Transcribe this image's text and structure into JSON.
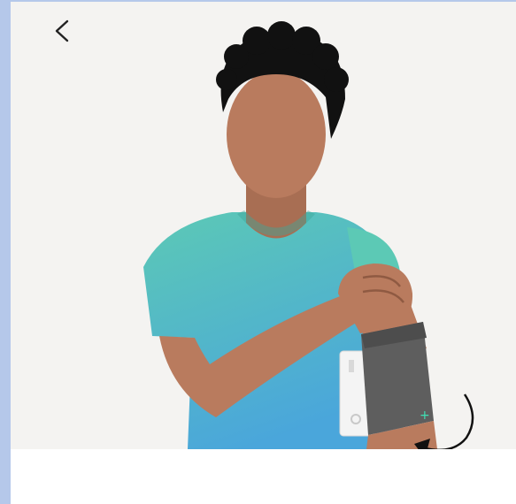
{
  "header": {
    "back_icon": "chevron-left-icon"
  },
  "illustration": {
    "subject": "person-applying-blood-pressure-cuff",
    "icons": [
      "cuff-plus-icon",
      "rotate-arrow-icon"
    ],
    "colors": {
      "background": "#f4f3f1",
      "skin": "#b97b5e",
      "skin_shadow": "#8f5a42",
      "hair": "#111111",
      "shirt_top": "#5cc9b5",
      "shirt_bottom": "#4aa6db",
      "cuff": "#5e5e5e",
      "monitor": "#f4f4f4",
      "accent": "#3fe0b4"
    }
  }
}
